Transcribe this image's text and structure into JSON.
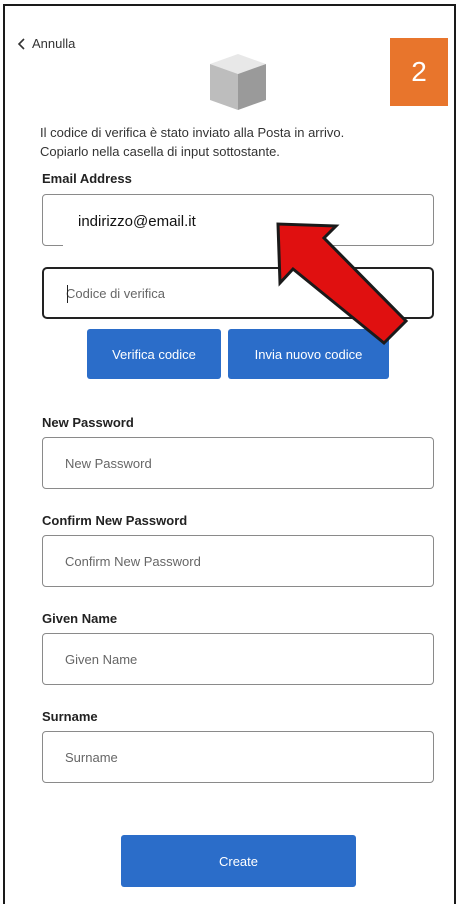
{
  "nav": {
    "cancel_label": "Annulla"
  },
  "badge": {
    "number": "2"
  },
  "intro": {
    "line1": "Il codice di verifica è stato inviato alla Posta in arrivo.",
    "line2": "Copiarlo nella casella di input sottostante."
  },
  "email": {
    "label": "Email Address",
    "value": "indirizzo@email.it"
  },
  "verification": {
    "placeholder": "Codice di verifica"
  },
  "buttons": {
    "verify": "Verifica codice",
    "resend": "Invia nuovo codice",
    "create": "Create"
  },
  "new_password": {
    "label": "New Password",
    "placeholder": "New Password"
  },
  "confirm_password": {
    "label": "Confirm New Password",
    "placeholder": "Confirm New Password"
  },
  "given_name": {
    "label": "Given Name",
    "placeholder": "Given Name"
  },
  "surname": {
    "label": "Surname",
    "placeholder": "Surname"
  },
  "colors": {
    "accent": "#2b6dc9",
    "badge": "#e8752c",
    "arrow": "#e01010"
  },
  "icons": {
    "back": "chevron-left-icon",
    "logo": "cube-icon",
    "annotation": "red-arrow-icon"
  }
}
